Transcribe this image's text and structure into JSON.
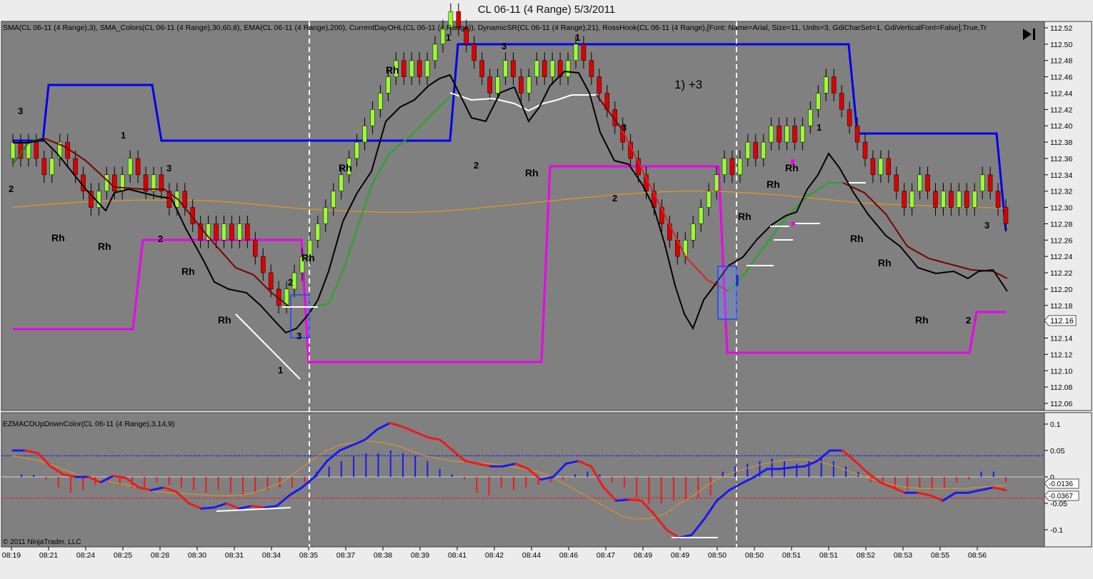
{
  "window": {
    "title": "CL 06-11 (4 Range)  5/3/2011"
  },
  "price_panel": {
    "indicators_label": "SMA(CL 06-11 (4 Range),3), SMA_Colors(CL 06-11 (4 Range),30,60,8), EMA(CL 06-11 (4 Range),200), CurrentDayOHL(CL 06-11 (4 Range)), DynamicSR(CL 06-11 (4 Range),21), RossHook(CL 06-11 (4 Range),[Font: Name=Arial, Size=11, Units=3, GdiCharSet=1, GdiVerticalFont=False],True,Tr",
    "trade_note": "1) +3",
    "last_price_label": "112.16",
    "y_ticks": [
      "112.52",
      "112.50",
      "112.48",
      "112.46",
      "112.44",
      "112.42",
      "112.40",
      "112.38",
      "112.36",
      "112.34",
      "112.32",
      "112.30",
      "112.28",
      "112.26",
      "112.24",
      "112.22",
      "112.20",
      "112.18",
      "112.16",
      "112.14",
      "112.12",
      "112.10",
      "112.08",
      "112.06"
    ]
  },
  "macd_panel": {
    "label": "EZMACDUpDownColor(CL 06-11 (4 Range),3,14,9)",
    "y_ticks": [
      "0.1",
      "0.05",
      "0",
      "-0.05",
      "-0.1"
    ],
    "value_label_1": "-0.0136",
    "value_label_2": "-0.0367",
    "copyright": "© 2011 NinjaTrader, LLC"
  },
  "x_axis": {
    "ticks": [
      "08:19",
      "08:21",
      "08:24",
      "08:25",
      "08:28",
      "08:30",
      "08:31",
      "08:34",
      "08:35",
      "08:37",
      "08:38",
      "08:39",
      "08:41",
      "08:42",
      "08:44",
      "08:46",
      "08:47",
      "08:49",
      "08:49",
      "08:50",
      "08:50",
      "08:51",
      "08:51",
      "08:52",
      "08:53",
      "08:55",
      "08:56"
    ]
  },
  "annotations": {
    "markers": [
      "3",
      "2",
      "Rh",
      "1",
      "Rh",
      "2",
      "3",
      "Rh",
      "Rh",
      "1",
      "Rh",
      "2",
      "3",
      "Rh",
      "Rh",
      "1",
      "3",
      "2",
      "Rh",
      "1",
      "3",
      "2",
      "Rh",
      "Rh",
      "Rh",
      "1",
      "Rh",
      "3",
      "Rh",
      "2",
      "Rh",
      "Rh"
    ]
  },
  "colors": {
    "background": "#808080",
    "up_bar": "#99ff33",
    "down_bar": "#dd0000",
    "day_high": "#0000ee",
    "day_low": "#ee00ee",
    "ema200": "#e8961e",
    "sma3": "#000000",
    "macd_up": "#1a1aee",
    "macd_down": "#ee1a1a"
  },
  "chart_data": {
    "type": "candlestick",
    "title": "CL 06-11 (4 Range)  5/3/2011",
    "ylim": [
      112.05,
      112.53
    ],
    "bar_range": 0.04,
    "directions": [
      1,
      -1,
      1,
      -1,
      -1,
      1,
      1,
      -1,
      -1,
      -1,
      -1,
      1,
      1,
      -1,
      1,
      1,
      -1,
      -1,
      1,
      -1,
      -1,
      1,
      -1,
      -1,
      -1,
      1,
      -1,
      1,
      -1,
      1,
      -1,
      -1,
      -1,
      -1,
      -1,
      1,
      1,
      1,
      1,
      1,
      1,
      1,
      1,
      1,
      1,
      1,
      1,
      1,
      1,
      1,
      -1,
      1,
      -1,
      1,
      1,
      1,
      1,
      -1,
      -1,
      -1,
      -1,
      -1,
      1,
      1,
      -1,
      -1,
      1,
      1,
      -1,
      1,
      -1,
      1,
      1,
      -1,
      -1,
      -1,
      -1,
      -1,
      -1,
      -1,
      -1,
      -1,
      -1,
      -1,
      -1,
      -1,
      1,
      1,
      1,
      1,
      1,
      1,
      -1,
      1,
      1,
      -1,
      1,
      1,
      -1,
      1,
      -1,
      1,
      1,
      1,
      1,
      -1,
      -1,
      -1,
      -1,
      -1,
      -1,
      1,
      -1,
      -1,
      -1,
      1,
      1,
      -1,
      -1,
      1,
      -1,
      1,
      -1,
      1,
      1,
      -1,
      -1,
      -1
    ],
    "ema200": [
      112.3,
      112.303,
      112.305,
      112.307,
      112.308,
      112.309,
      112.309,
      112.309,
      112.308,
      112.306,
      112.303,
      112.3,
      112.298,
      112.296,
      112.295,
      112.294,
      112.294,
      112.295,
      112.297,
      112.3,
      112.303,
      112.306,
      112.309,
      112.312,
      112.315,
      112.317,
      112.319,
      112.32,
      112.32,
      112.319,
      112.317,
      112.315,
      112.312,
      112.309,
      112.306,
      112.304,
      112.303,
      112.302,
      112.301,
      112.3,
      112.299
    ],
    "macd": {
      "ylim": [
        -0.125,
        0.115
      ],
      "zero": 0,
      "upper_band": 0.04,
      "lower_band": -0.04,
      "histogram": [
        0.005,
        0.004,
        -0.005,
        -0.02,
        -0.03,
        -0.025,
        -0.015,
        -0.01,
        -0.015,
        -0.02,
        -0.02,
        -0.01,
        -0.015,
        -0.02,
        -0.025,
        -0.03,
        -0.025,
        -0.03,
        -0.035,
        -0.03,
        -0.025,
        -0.02,
        -0.02,
        -0.01,
        0.01,
        0.02,
        0.03,
        0.04,
        0.045,
        0.045,
        0.05,
        0.045,
        0.04,
        0.03,
        0.015,
        0.005,
        -0.005,
        -0.03,
        -0.035,
        -0.02,
        -0.025,
        -0.02,
        -0.015,
        -0.01,
        -0.005,
        0.005,
        0.01,
        0.005,
        -0.01,
        -0.02,
        -0.04,
        -0.05,
        -0.05,
        -0.045,
        -0.045,
        -0.04,
        -0.035,
        0.01,
        0.02,
        0.025,
        0.03,
        0.035,
        0.03,
        0.025,
        0.03,
        0.035,
        0.03,
        0.02,
        0.01,
        -0.01,
        -0.015,
        -0.02,
        -0.025,
        -0.02,
        -0.025,
        -0.02,
        -0.01,
        -0.005,
        0.01,
        0.01,
        -0.01
      ],
      "macd_line": [
        0.05,
        0.05,
        0.045,
        0.02,
        0.005,
        0.0,
        0.0,
        -0.01,
        0.002,
        -0.002,
        -0.02,
        -0.025,
        -0.02,
        -0.028,
        -0.05,
        -0.06,
        -0.058,
        -0.05,
        -0.06,
        -0.055,
        -0.058,
        -0.055,
        -0.035,
        -0.02,
        0.0,
        0.03,
        0.05,
        0.06,
        0.07,
        0.09,
        0.102,
        0.095,
        0.085,
        0.075,
        0.07,
        0.05,
        0.03,
        0.025,
        0.02,
        0.02,
        0.025,
        0.015,
        -0.005,
        0.0,
        0.025,
        0.03,
        0.02,
        -0.02,
        -0.045,
        -0.043,
        -0.045,
        -0.07,
        -0.1,
        -0.115,
        -0.11,
        -0.08,
        -0.045,
        -0.025,
        -0.012,
        0.0,
        0.015,
        0.015,
        0.018,
        0.02,
        0.03,
        0.05,
        0.05,
        0.03,
        0.008,
        -0.01,
        -0.02,
        -0.03,
        -0.03,
        -0.035,
        -0.045,
        -0.03,
        -0.03,
        -0.025,
        -0.02,
        -0.025
      ],
      "signal_line": [
        0.04,
        0.035,
        0.03,
        0.02,
        0.01,
        0.0,
        -0.005,
        -0.01,
        -0.015,
        -0.02,
        -0.028,
        -0.03,
        -0.032,
        -0.033,
        -0.035,
        -0.036,
        -0.035,
        -0.03,
        -0.02,
        -0.01,
        0.01,
        0.03,
        0.048,
        0.06,
        0.065,
        0.068,
        0.065,
        0.06,
        0.05,
        0.04,
        0.035,
        0.03,
        0.028,
        0.026,
        0.024,
        0.02,
        0.015,
        0.01,
        0.0,
        -0.015,
        -0.03,
        -0.045,
        -0.06,
        -0.075,
        -0.08,
        -0.078,
        -0.07,
        -0.05,
        -0.035,
        -0.015,
        0.0,
        0.01,
        0.018,
        0.025,
        0.03,
        0.033,
        0.033,
        0.028,
        0.02,
        0.01,
        0.0,
        -0.008,
        -0.015,
        -0.02,
        -0.022,
        -0.022,
        -0.022,
        -0.022,
        -0.02,
        -0.018,
        -0.016
      ]
    }
  }
}
